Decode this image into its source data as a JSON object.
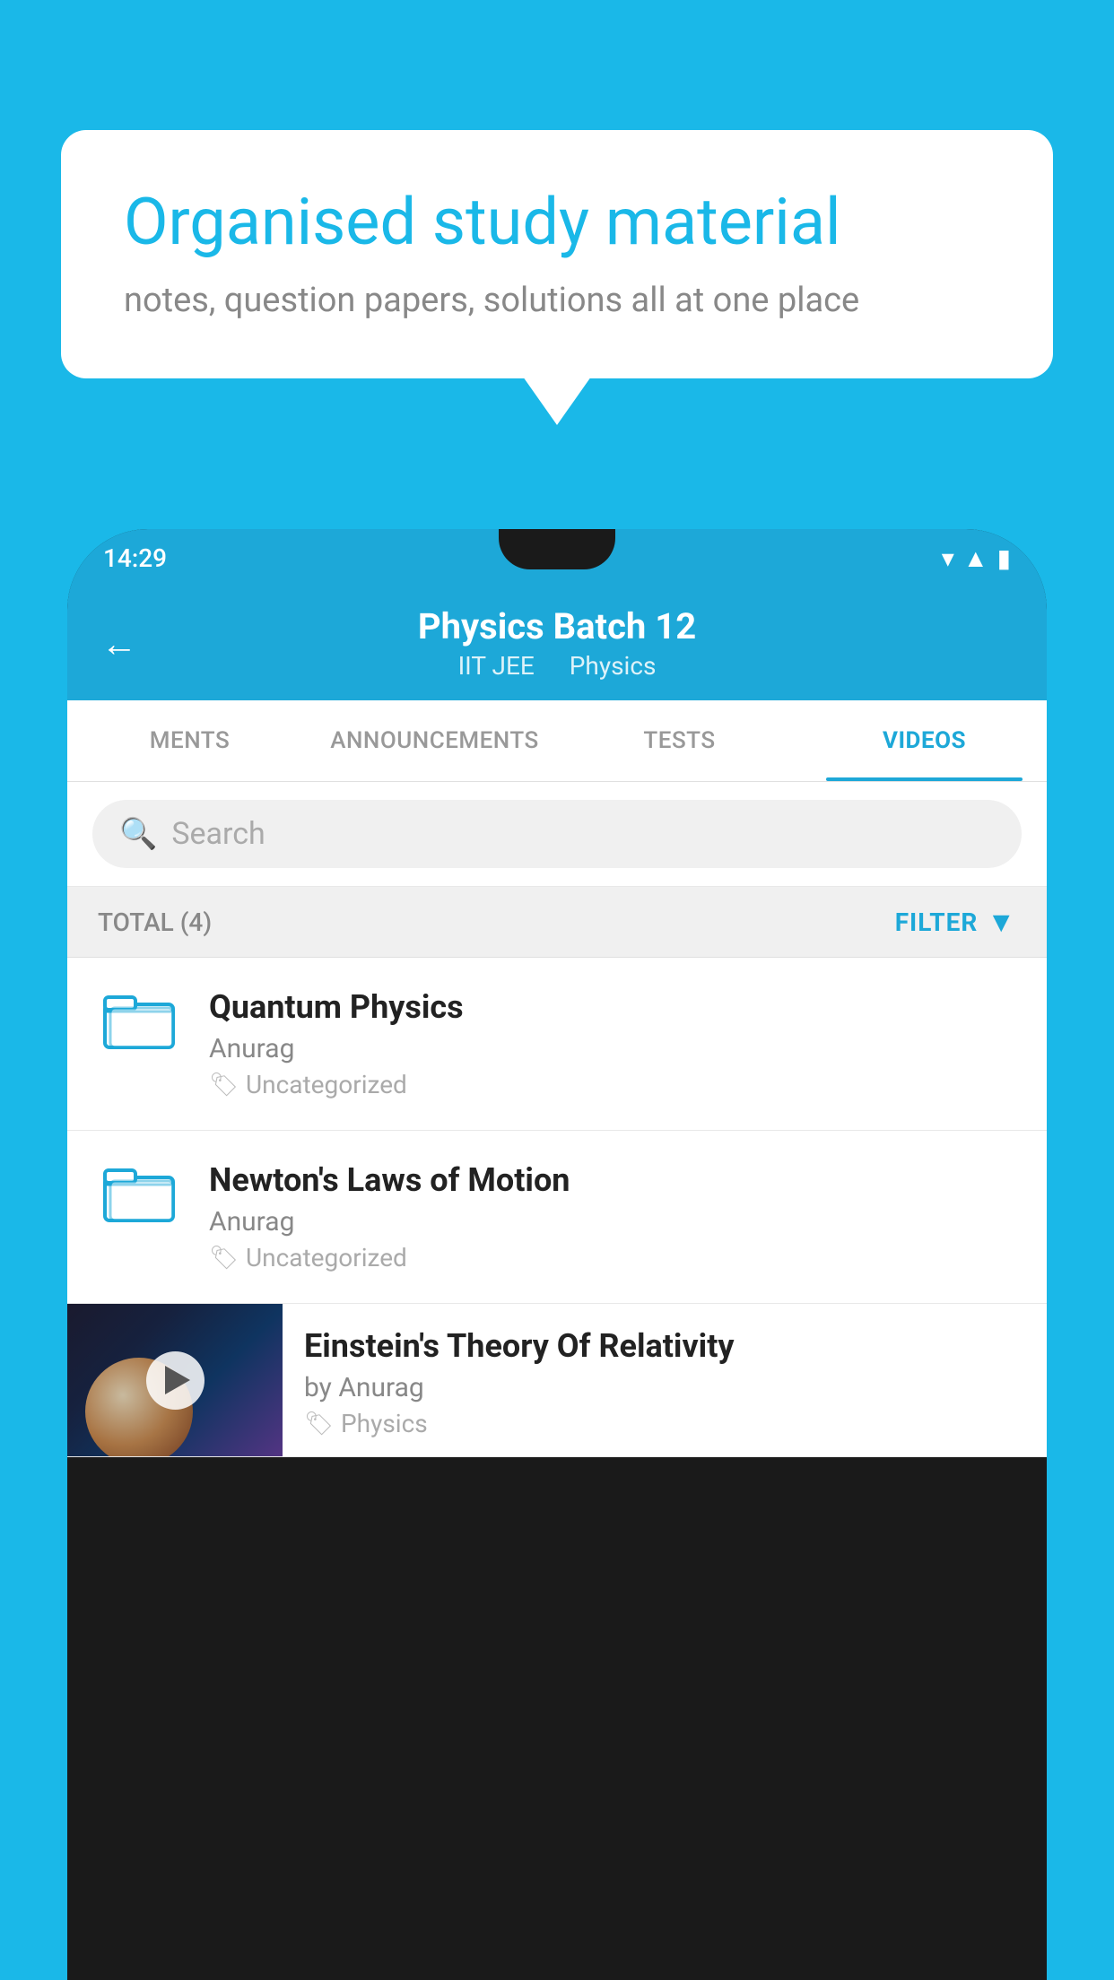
{
  "page": {
    "background_color": "#1ab8e8"
  },
  "hero": {
    "title": "Organised study material",
    "subtitle": "notes, question papers, solutions all at one place"
  },
  "phone": {
    "status_bar": {
      "time": "14:29",
      "icons": [
        "wifi",
        "signal",
        "battery"
      ]
    },
    "header": {
      "back_label": "←",
      "title": "Physics Batch 12",
      "subtitle_part1": "IIT JEE",
      "subtitle_part2": "Physics"
    },
    "tabs": [
      {
        "label": "MENTS",
        "active": false
      },
      {
        "label": "ANNOUNCEMENTS",
        "active": false
      },
      {
        "label": "TESTS",
        "active": false
      },
      {
        "label": "VIDEOS",
        "active": true
      }
    ],
    "search": {
      "placeholder": "Search"
    },
    "filter_bar": {
      "total_label": "TOTAL (4)",
      "filter_label": "FILTER"
    },
    "videos": [
      {
        "title": "Quantum Physics",
        "author": "Anurag",
        "tag": "Uncategorized",
        "type": "folder"
      },
      {
        "title": "Newton's Laws of Motion",
        "author": "Anurag",
        "tag": "Uncategorized",
        "type": "folder"
      },
      {
        "title": "Einstein's Theory Of Relativity",
        "author": "by Anurag",
        "tag": "Physics",
        "type": "video"
      }
    ]
  }
}
